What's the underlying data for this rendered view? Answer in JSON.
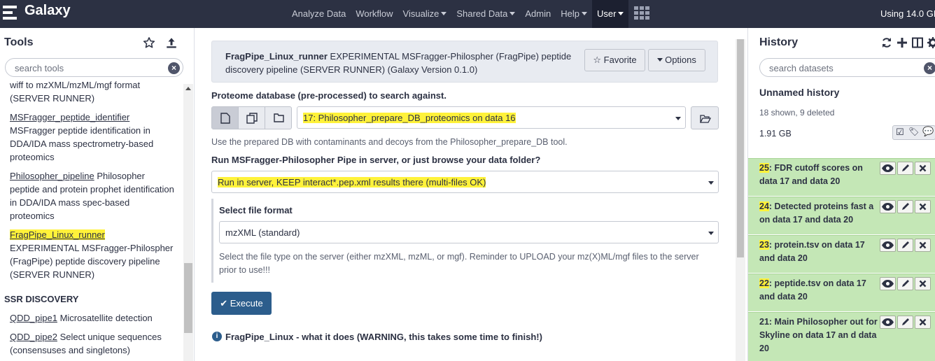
{
  "navbar": {
    "brand": "Galaxy",
    "items": [
      {
        "label": "Analyze Data",
        "dropdown": false
      },
      {
        "label": "Workflow",
        "dropdown": false
      },
      {
        "label": "Visualize",
        "dropdown": true
      },
      {
        "label": "Shared Data",
        "dropdown": true
      },
      {
        "label": "Admin",
        "dropdown": false
      },
      {
        "label": "Help",
        "dropdown": true
      },
      {
        "label": "User",
        "dropdown": true,
        "active": true
      }
    ],
    "apps_icon": "grid-icon",
    "usage": "Using 14.0 GB"
  },
  "tools_panel": {
    "title": "Tools",
    "icons": [
      "star-icon",
      "upload-icon"
    ],
    "search_placeholder": "search tools",
    "tools": [
      {
        "name": "",
        "desc": "wiff to mzXML/mzML/mgf format (SERVER RUNNER)"
      },
      {
        "name": "MSFragger_peptide_identifier",
        "desc": "MSFragger peptide identification in DDA/IDA mass spectrometry-based proteomics"
      },
      {
        "name": "Philosopher_pipeline",
        "desc": "Philosopher peptide and protein prophet identification in DDA/IDA mass spec-based proteomics"
      },
      {
        "name": "FragPipe_Linux_runner",
        "desc": "EXPERIMENTAL MSFragger-Philospher (FragPipe) peptide discovery pipeline (SERVER RUNNER)"
      }
    ],
    "section": "SSR DISCOVERY",
    "section_tools": [
      {
        "name": "QDD_pipe1",
        "desc": "Microsatellite detection"
      },
      {
        "name": "QDD_pipe2",
        "desc": "Select unique sequences (consensuses and singletons)"
      }
    ]
  },
  "tool_form": {
    "tool_name": "FragPipe_Linux_runner",
    "tool_desc": "EXPERIMENTAL MSFragger-Philospher (FragPipe) peptide discovery pipeline (SERVER RUNNER) (Galaxy Version 0.1.0)",
    "favorite_label": "Favorite",
    "options_label": "Options",
    "db_label": "Proteome database (pre-processed) to search against.",
    "db_value": "17: Philosopher_prepare_DB_proteomics on data 16",
    "db_help": "Use the prepared DB with contaminants and decoys from the Philosopher_prepare_DB tool.",
    "run_label": "Run MSFragger-Philosopher Pipe in server, or just browse your data folder?",
    "run_value": "Run in server, KEEP interact*.pep.xml results there (multi-files OK)",
    "format_label": "Select file format",
    "format_value": "mzXML (standard)",
    "format_help": "Select the file type on the server (either mzXML, mzML, or mgf). Reminder to UPLOAD your mz(X)ML/mgf files to the server prior to use!!!",
    "execute_label": "Execute",
    "about_title": "FragPipe_Linux",
    "about_text": "- what it does (WARNING, this takes some time to finish!)"
  },
  "history": {
    "title": "History",
    "icons": [
      "refresh-icon",
      "plus-icon",
      "columns-icon",
      "gear-icon"
    ],
    "search_placeholder": "search datasets",
    "name": "Unnamed history",
    "counts": "18 shown, 9 deleted",
    "size": "1.91 GB",
    "datasets": [
      {
        "hid": "25",
        "title": "FDR cutoff scores on data 17 and data 20"
      },
      {
        "hid": "24",
        "title": "Detected proteins fast a on data 17 and data 20"
      },
      {
        "hid": "23",
        "title": "protein.tsv on data 17 and data 20"
      },
      {
        "hid": "22",
        "title": "peptide.tsv on data 17 and data 20"
      },
      {
        "hid": "21",
        "title": "Main Philosopher out for Skyline on data 17 an d data 20"
      }
    ]
  },
  "colors": {
    "navbar": "#2c3143",
    "dataset_ok": "#c4e7b6",
    "highlight": "#fff23a",
    "primary": "#2c5d8c"
  }
}
